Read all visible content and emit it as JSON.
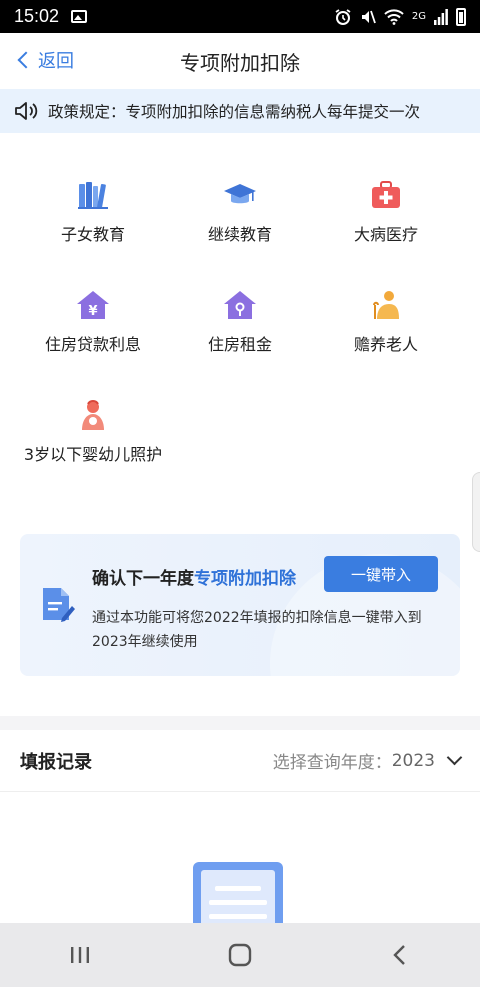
{
  "status_bar": {
    "time": "15:02",
    "network": "2G"
  },
  "nav": {
    "back_label": "返回",
    "title": "专项附加扣除"
  },
  "notice": {
    "text": "政策规定：专项附加扣除的信息需纳税人每年提交一次"
  },
  "categories": [
    {
      "label": "子女教育",
      "icon": "books-icon"
    },
    {
      "label": "继续教育",
      "icon": "graduation-cap-icon"
    },
    {
      "label": "大病医疗",
      "icon": "medical-kit-icon"
    },
    {
      "label": "住房贷款利息",
      "icon": "house-yen-icon"
    },
    {
      "label": "住房租金",
      "icon": "house-key-icon"
    },
    {
      "label": "赡养老人",
      "icon": "elderly-icon"
    },
    {
      "label": "3岁以下婴幼儿照护",
      "icon": "mother-baby-icon"
    }
  ],
  "promo": {
    "title_prefix": "确认下一年度",
    "title_highlight": "专项附加扣除",
    "button_label": "一键带入",
    "description": "通过本功能可将您2022年填报的扣除信息一键带入到2023年继续使用"
  },
  "records": {
    "title": "填报记录",
    "year_prompt": "选择查询年度：",
    "year_value": "2023"
  },
  "colors": {
    "accent": "#3a7de0",
    "notice_bg": "#e8f2fd"
  }
}
